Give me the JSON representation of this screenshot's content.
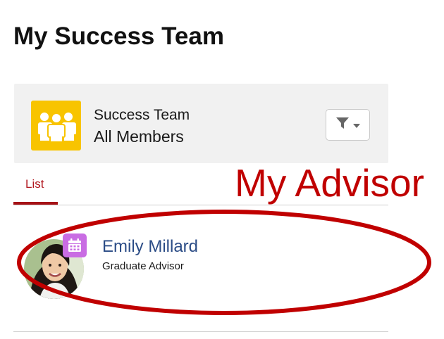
{
  "page": {
    "title": "My Success Team"
  },
  "header": {
    "title": "Success Team",
    "subtitle": "All Members",
    "icon": "team-icon",
    "filter_icon": "filter-icon",
    "accent_color": "#f8c400"
  },
  "annotation": {
    "label": "My Advisor",
    "color": "#c00000"
  },
  "tabs": [
    {
      "label": "List",
      "selected": true
    }
  ],
  "members": [
    {
      "name": "Emily Millard",
      "role": "Graduate Advisor",
      "badge_icon": "calendar-icon",
      "badge_color": "#c96ce3"
    }
  ]
}
